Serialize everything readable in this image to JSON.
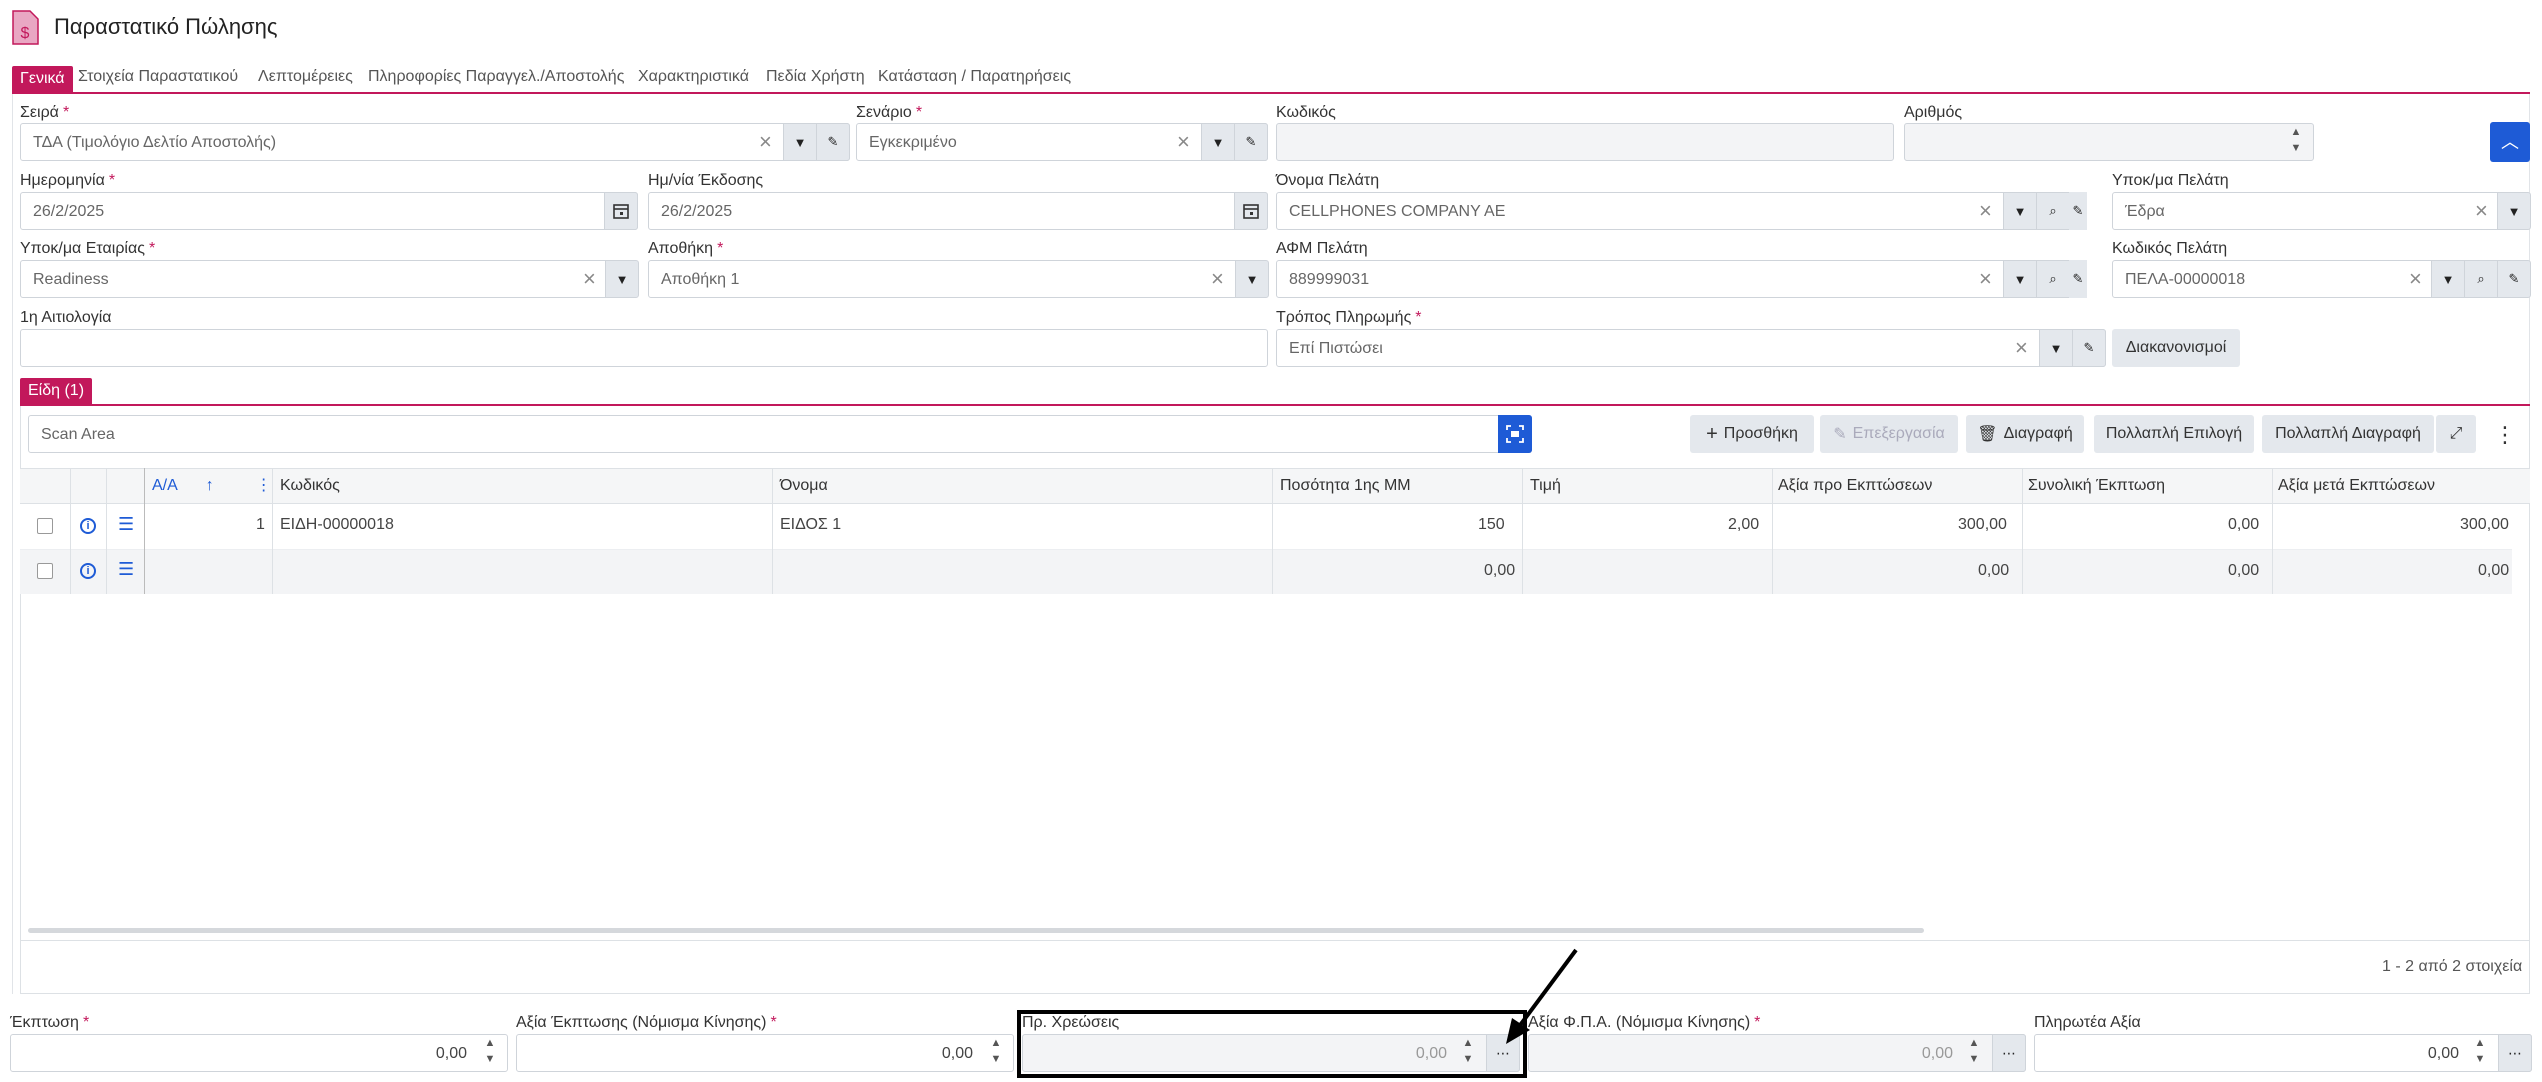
{
  "header": {
    "title": "Παραστατικό Πώλησης",
    "icon": "dollar-document-icon"
  },
  "tabs": [
    {
      "label": "Γενικά"
    },
    {
      "label": "Στοιχεία Παραστατικού"
    },
    {
      "label": "Λεπτομέρειες"
    },
    {
      "label": "Πληροφορίες Παραγγελ./Αποστολής"
    },
    {
      "label": "Χαρακτηριστικά"
    },
    {
      "label": "Πεδία Χρήστη"
    },
    {
      "label": "Κατάσταση / Παρατηρήσεις"
    }
  ],
  "form": {
    "series": {
      "label": "Σειρά",
      "value": "ΤΔΑ (Τιμολόγιο Δελτίο Αποστολής)"
    },
    "scenario": {
      "label": "Σενάριο",
      "value": "Εγκεκριμένο"
    },
    "code": {
      "label": "Κωδικός",
      "value": ""
    },
    "number": {
      "label": "Αριθμός",
      "value": ""
    },
    "date": {
      "label": "Ημερομηνία",
      "value": "26/2/2025"
    },
    "issue_date": {
      "label": "Ημ/νία Έκδοσης",
      "value": "26/2/2025"
    },
    "customer_name": {
      "label": "Όνομα Πελάτη",
      "value": "CELLPHONES COMPANY AE"
    },
    "customer_branch": {
      "label": "Υποκ/μα Πελάτη",
      "value": "Έδρα"
    },
    "company_branch": {
      "label": "Υποκ/μα Εταιρίας",
      "value": "Readiness"
    },
    "warehouse": {
      "label": "Αποθήκη",
      "value": "Αποθήκη 1"
    },
    "customer_vat": {
      "label": "ΑΦΜ Πελάτη",
      "value": "889999031"
    },
    "customer_code": {
      "label": "Κωδικός Πελάτη",
      "value": "ΠΕΛΑ-00000018"
    },
    "reason": {
      "label": "1η Αιτιολογία",
      "value": ""
    },
    "payment_method": {
      "label": "Τρόπος Πληρωμής",
      "value": "Επί Πιστώσει"
    },
    "settlements_label": "Διακανονισμοί"
  },
  "items_section": {
    "tab_label": "Είδη (1)",
    "scan_placeholder": "Scan Area",
    "add_label": "Προσθήκη",
    "edit_label": "Επεξεργασία",
    "delete_label": "Διαγραφή",
    "multi_select_label": "Πολλαπλή Επιλογή",
    "multi_delete_label": "Πολλαπλή Διαγραφή",
    "columns": [
      "Α/Α",
      "Κωδικός",
      "Όνομα",
      "Ποσότητα 1ης ΜΜ",
      "Τιμή",
      "Αξία προ Εκπτώσεων",
      "Συνολική Έκπτωση",
      "Αξία μετά Εκπτώσεων"
    ],
    "rows": [
      {
        "aa": "1",
        "code": "ΕΙΔΗ-00000018",
        "name": "ΕΙΔΟΣ 1",
        "qty": "150",
        "price": "2,00",
        "value_before": "300,00",
        "discount": "0,00",
        "value_after": "300,00"
      },
      {
        "aa": "",
        "code": "",
        "name": "",
        "qty": "0,00",
        "price": "",
        "value_before": "0,00",
        "discount": "0,00",
        "value_after": "0,00"
      }
    ],
    "pagination": "1 - 2 από 2 στοιχεία"
  },
  "totals": {
    "discount": {
      "label": "Έκπτωση",
      "value": "0,00"
    },
    "discount_value": {
      "label": "Αξία Έκπτωσης (Νόμισμα Κίνησης)",
      "value": "0,00"
    },
    "extra_charges": {
      "label": "Πρ. Χρεώσεις",
      "value": "0,00"
    },
    "vat_value": {
      "label": "Αξία Φ.Π.Α. (Νόμισμα Κίνησης)",
      "value": "0,00"
    },
    "payable": {
      "label": "Πληρωτέα Αξία",
      "value": "0,00"
    }
  },
  "colors": {
    "accent": "#c2185b",
    "primary": "#1e5bd6",
    "annotation": "#000000"
  }
}
